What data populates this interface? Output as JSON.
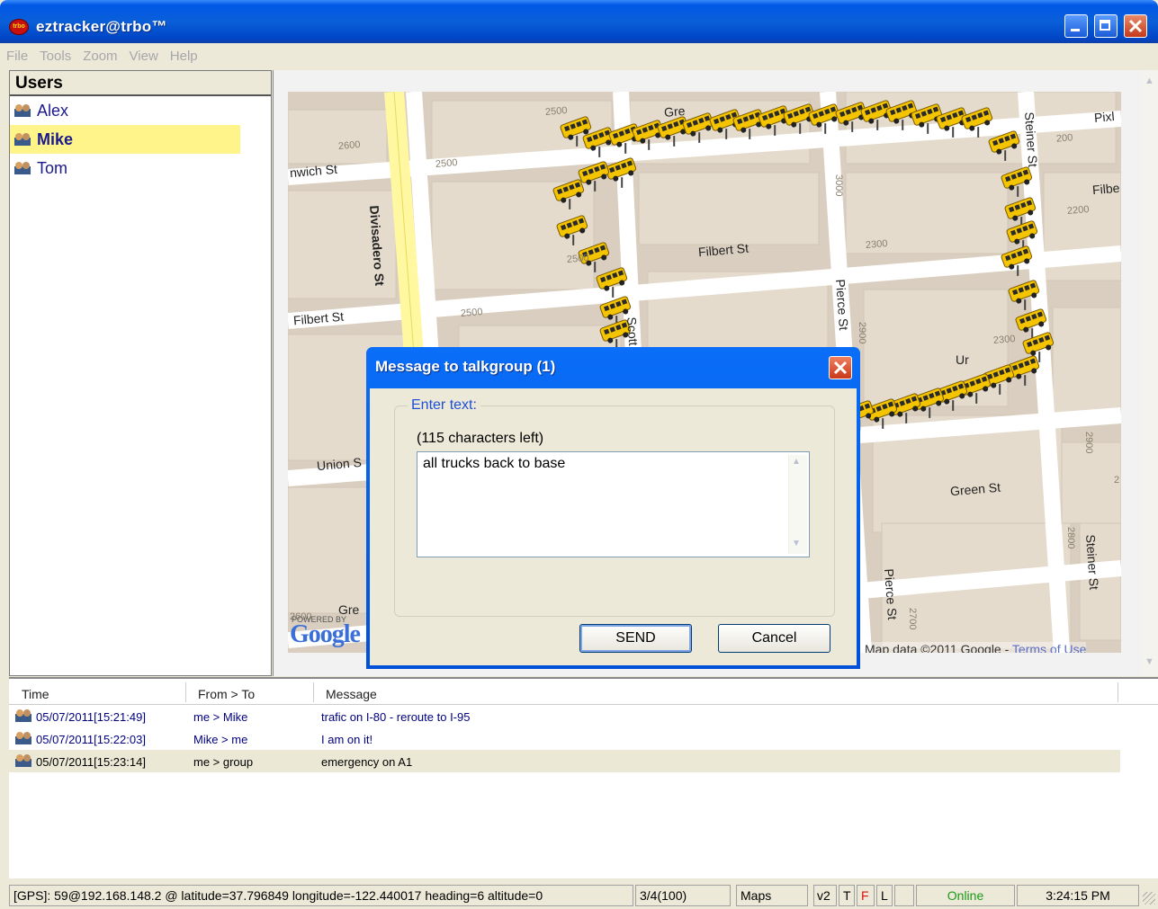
{
  "window": {
    "title": "eztracker@trbo™",
    "logo_text": "trbo"
  },
  "menu": [
    "File",
    "Tools",
    "Zoom",
    "View",
    "Help"
  ],
  "users": {
    "header": "Users",
    "items": [
      {
        "name": "Alex",
        "selected": false
      },
      {
        "name": "Mike",
        "selected": true
      },
      {
        "name": "Tom",
        "selected": false
      }
    ]
  },
  "map": {
    "streets": [
      "Divisadero St",
      "Filbert St",
      "Filbert St",
      "nwich St",
      "Union S",
      "Scott",
      "Pierce St",
      "Pierce St",
      "Steiner St",
      "Steiner St",
      "Green St",
      "Gre",
      "Gre",
      "Pixl",
      "Filbe",
      "Ur"
    ],
    "numbers": [
      "2500",
      "2600",
      "2500",
      "2500",
      "2500",
      "3000",
      "2300",
      "2300",
      "2200",
      "200",
      "2900",
      "2900",
      "2800",
      "2700",
      "2600",
      "2"
    ],
    "powered_by": "POWERED BY",
    "google": "Google",
    "copyright": "Map data ©2011 Google -",
    "terms": "Terms of Use",
    "marker_icon": "school-bus-icon",
    "marker_count": 34
  },
  "dialog": {
    "title": "Message to talkgroup (1)",
    "group_label": "Enter text:",
    "char_count": "(115 characters left)",
    "text_value": "all trucks back to base",
    "send_label": "SEND",
    "cancel_label": "Cancel"
  },
  "messages": {
    "columns": [
      "Time",
      "From > To",
      "Message"
    ],
    "rows": [
      {
        "time": "05/07/2011[15:21:49]",
        "from_to": "me > Mike",
        "message": "trafic on I-80 - reroute to I-95",
        "highlighted": false
      },
      {
        "time": "05/07/2011[15:22:03]",
        "from_to": "Mike > me",
        "message": "I am on it!",
        "highlighted": false
      },
      {
        "time": "05/07/2011[15:23:14]",
        "from_to": "me > group",
        "message": "emergency on A1",
        "highlighted": true
      }
    ]
  },
  "status": {
    "gps": "[GPS]: 59@192.168.148.2 @ latitude=37.796849 longitude=-122.440017 heading=6 altitude=0",
    "count": "3/4(100)",
    "maps": "Maps",
    "v2": "v2",
    "t": "T",
    "f": "F",
    "l": "L",
    "online": "Online",
    "time": "3:24:15 PM"
  },
  "colors": {
    "title_blue": "#0058e6",
    "selected_user": "#fff48a",
    "online_green": "#1a9a1a",
    "status_f_red": "#e01010",
    "user_text": "#1a1a8c"
  }
}
